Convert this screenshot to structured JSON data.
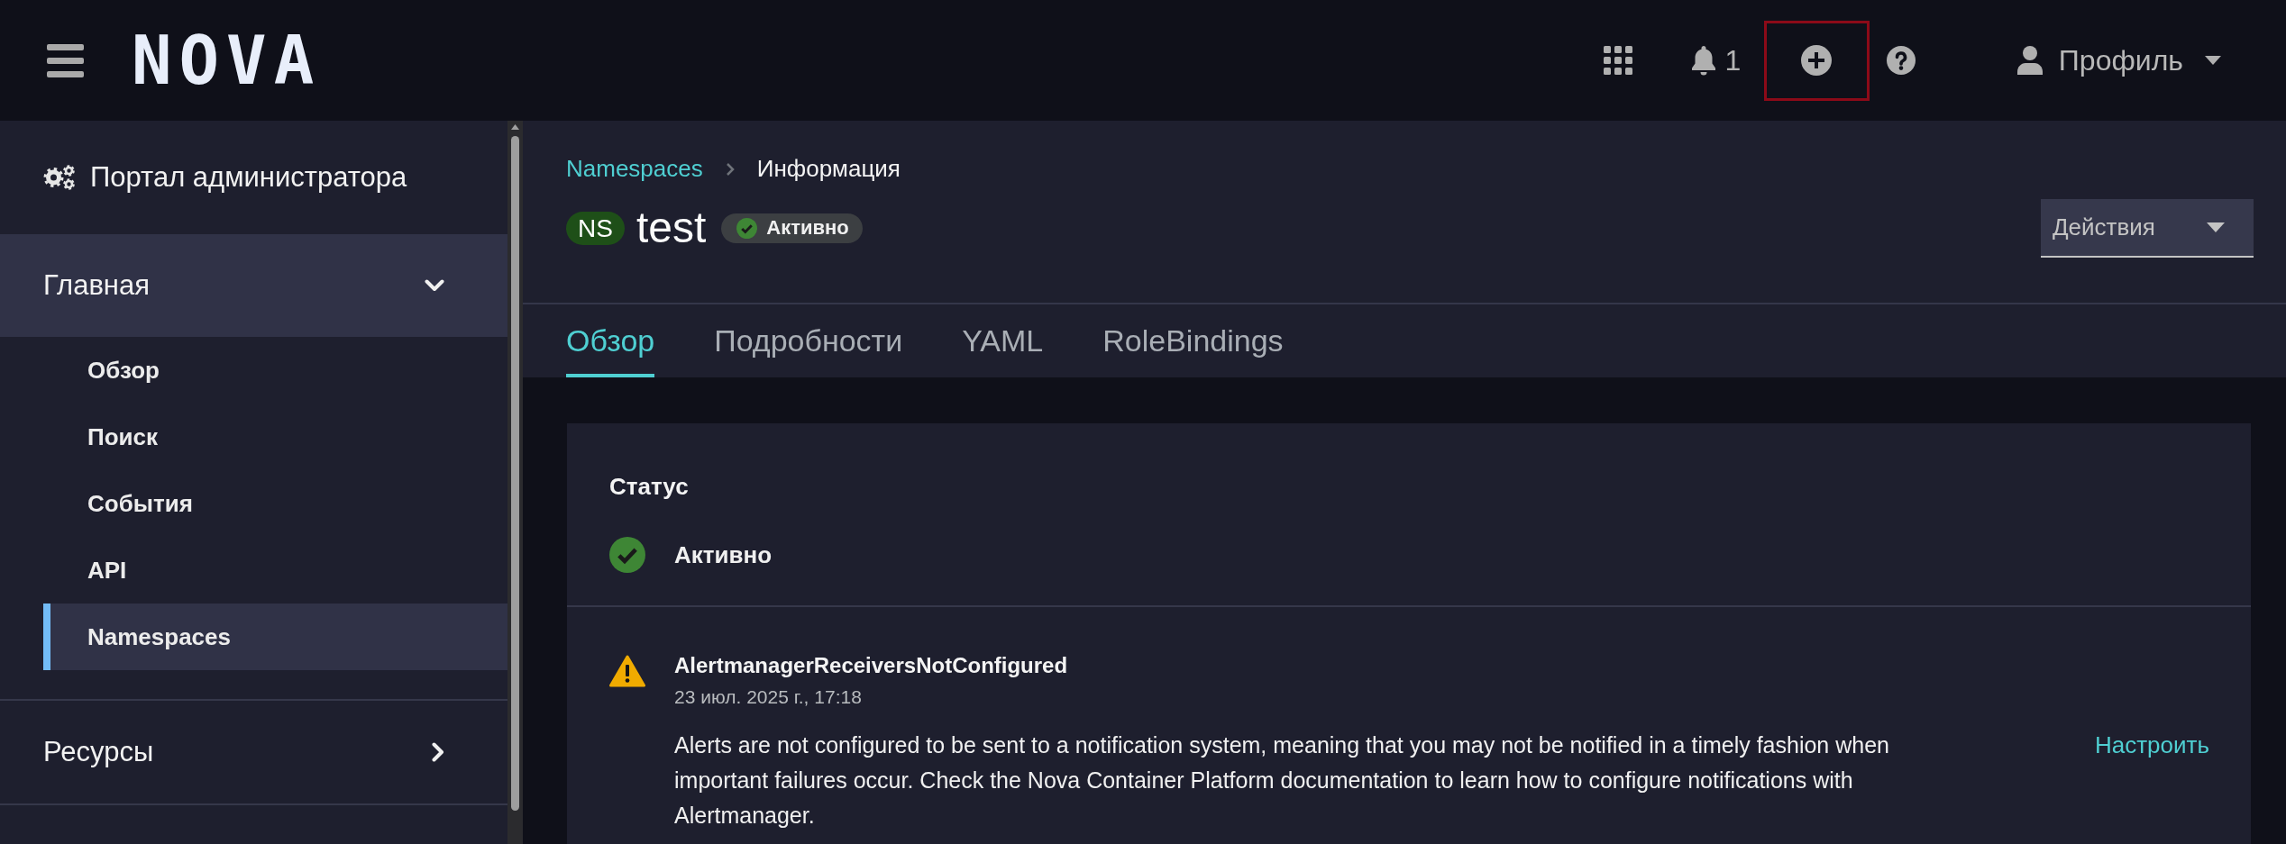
{
  "topbar": {
    "logo": "NOVA",
    "tools": [
      {
        "kind": "apps",
        "highlighted": false
      },
      {
        "kind": "notifications",
        "count": "1",
        "highlighted": false
      },
      {
        "kind": "add",
        "highlighted": true
      },
      {
        "kind": "help",
        "highlighted": false
      }
    ],
    "profile": {
      "label": "Профиль"
    }
  },
  "sidebar": {
    "perspective": "Портал администратора",
    "sections": [
      {
        "label": "Главная",
        "expanded": true,
        "items": [
          {
            "label": "Обзор",
            "selected": false
          },
          {
            "label": "Поиск",
            "selected": false
          },
          {
            "label": "События",
            "selected": false
          },
          {
            "label": "API",
            "selected": false
          },
          {
            "label": "Namespaces",
            "selected": true
          }
        ]
      },
      {
        "label": "Ресурсы",
        "expanded": false
      }
    ]
  },
  "breadcrumb": [
    {
      "kind": "link",
      "label": "Namespaces"
    },
    {
      "kind": "current",
      "label": "Информация"
    }
  ],
  "header": {
    "badge": "NS",
    "name": "test",
    "status": "Активно",
    "actions": "Действия"
  },
  "tabs": [
    {
      "label": "Обзор",
      "selected": true
    },
    {
      "label": "Подробности",
      "selected": false
    },
    {
      "label": "YAML",
      "selected": false
    },
    {
      "label": "RoleBindings",
      "selected": false
    }
  ],
  "status_card": {
    "title": "Статус",
    "status": "Активно",
    "alerts": [
      {
        "kind": "warning",
        "title": "AlertmanagerReceiversNotConfigured",
        "time": "23 июл. 2025 г., 17:18",
        "message": "Alerts are not configured to be sent to a notification system, meaning that you may not be notified in a timely fashion when important failures occur. Check the Nova Container Platform documentation to learn how to configure notifications with Alertmanager.",
        "action": "Настроить"
      }
    ]
  }
}
